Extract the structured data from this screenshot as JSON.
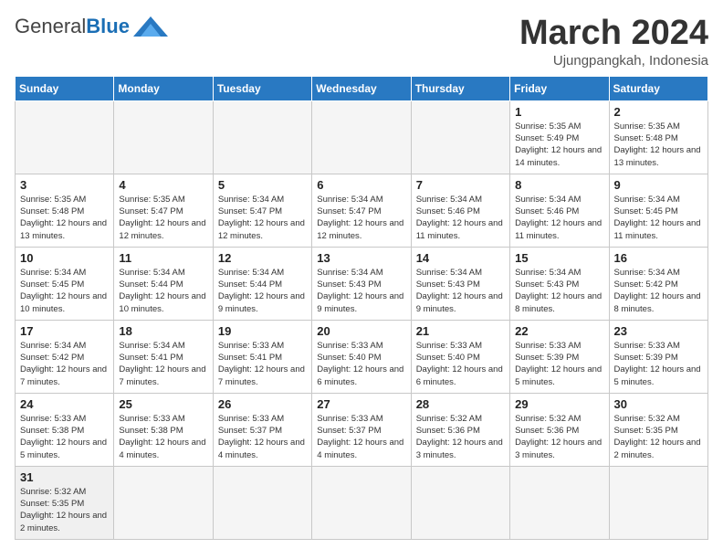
{
  "header": {
    "logo_general": "General",
    "logo_blue": "Blue",
    "month_title": "March 2024",
    "location": "Ujungpangkah, Indonesia"
  },
  "weekdays": [
    "Sunday",
    "Monday",
    "Tuesday",
    "Wednesday",
    "Thursday",
    "Friday",
    "Saturday"
  ],
  "weeks": [
    [
      {
        "day": "",
        "info": ""
      },
      {
        "day": "",
        "info": ""
      },
      {
        "day": "",
        "info": ""
      },
      {
        "day": "",
        "info": ""
      },
      {
        "day": "",
        "info": ""
      },
      {
        "day": "1",
        "info": "Sunrise: 5:35 AM\nSunset: 5:49 PM\nDaylight: 12 hours and 14 minutes."
      },
      {
        "day": "2",
        "info": "Sunrise: 5:35 AM\nSunset: 5:48 PM\nDaylight: 12 hours and 13 minutes."
      }
    ],
    [
      {
        "day": "3",
        "info": "Sunrise: 5:35 AM\nSunset: 5:48 PM\nDaylight: 12 hours and 13 minutes."
      },
      {
        "day": "4",
        "info": "Sunrise: 5:35 AM\nSunset: 5:47 PM\nDaylight: 12 hours and 12 minutes."
      },
      {
        "day": "5",
        "info": "Sunrise: 5:34 AM\nSunset: 5:47 PM\nDaylight: 12 hours and 12 minutes."
      },
      {
        "day": "6",
        "info": "Sunrise: 5:34 AM\nSunset: 5:47 PM\nDaylight: 12 hours and 12 minutes."
      },
      {
        "day": "7",
        "info": "Sunrise: 5:34 AM\nSunset: 5:46 PM\nDaylight: 12 hours and 11 minutes."
      },
      {
        "day": "8",
        "info": "Sunrise: 5:34 AM\nSunset: 5:46 PM\nDaylight: 12 hours and 11 minutes."
      },
      {
        "day": "9",
        "info": "Sunrise: 5:34 AM\nSunset: 5:45 PM\nDaylight: 12 hours and 11 minutes."
      }
    ],
    [
      {
        "day": "10",
        "info": "Sunrise: 5:34 AM\nSunset: 5:45 PM\nDaylight: 12 hours and 10 minutes."
      },
      {
        "day": "11",
        "info": "Sunrise: 5:34 AM\nSunset: 5:44 PM\nDaylight: 12 hours and 10 minutes."
      },
      {
        "day": "12",
        "info": "Sunrise: 5:34 AM\nSunset: 5:44 PM\nDaylight: 12 hours and 9 minutes."
      },
      {
        "day": "13",
        "info": "Sunrise: 5:34 AM\nSunset: 5:43 PM\nDaylight: 12 hours and 9 minutes."
      },
      {
        "day": "14",
        "info": "Sunrise: 5:34 AM\nSunset: 5:43 PM\nDaylight: 12 hours and 9 minutes."
      },
      {
        "day": "15",
        "info": "Sunrise: 5:34 AM\nSunset: 5:43 PM\nDaylight: 12 hours and 8 minutes."
      },
      {
        "day": "16",
        "info": "Sunrise: 5:34 AM\nSunset: 5:42 PM\nDaylight: 12 hours and 8 minutes."
      }
    ],
    [
      {
        "day": "17",
        "info": "Sunrise: 5:34 AM\nSunset: 5:42 PM\nDaylight: 12 hours and 7 minutes."
      },
      {
        "day": "18",
        "info": "Sunrise: 5:34 AM\nSunset: 5:41 PM\nDaylight: 12 hours and 7 minutes."
      },
      {
        "day": "19",
        "info": "Sunrise: 5:33 AM\nSunset: 5:41 PM\nDaylight: 12 hours and 7 minutes."
      },
      {
        "day": "20",
        "info": "Sunrise: 5:33 AM\nSunset: 5:40 PM\nDaylight: 12 hours and 6 minutes."
      },
      {
        "day": "21",
        "info": "Sunrise: 5:33 AM\nSunset: 5:40 PM\nDaylight: 12 hours and 6 minutes."
      },
      {
        "day": "22",
        "info": "Sunrise: 5:33 AM\nSunset: 5:39 PM\nDaylight: 12 hours and 5 minutes."
      },
      {
        "day": "23",
        "info": "Sunrise: 5:33 AM\nSunset: 5:39 PM\nDaylight: 12 hours and 5 minutes."
      }
    ],
    [
      {
        "day": "24",
        "info": "Sunrise: 5:33 AM\nSunset: 5:38 PM\nDaylight: 12 hours and 5 minutes."
      },
      {
        "day": "25",
        "info": "Sunrise: 5:33 AM\nSunset: 5:38 PM\nDaylight: 12 hours and 4 minutes."
      },
      {
        "day": "26",
        "info": "Sunrise: 5:33 AM\nSunset: 5:37 PM\nDaylight: 12 hours and 4 minutes."
      },
      {
        "day": "27",
        "info": "Sunrise: 5:33 AM\nSunset: 5:37 PM\nDaylight: 12 hours and 4 minutes."
      },
      {
        "day": "28",
        "info": "Sunrise: 5:32 AM\nSunset: 5:36 PM\nDaylight: 12 hours and 3 minutes."
      },
      {
        "day": "29",
        "info": "Sunrise: 5:32 AM\nSunset: 5:36 PM\nDaylight: 12 hours and 3 minutes."
      },
      {
        "day": "30",
        "info": "Sunrise: 5:32 AM\nSunset: 5:35 PM\nDaylight: 12 hours and 2 minutes."
      }
    ],
    [
      {
        "day": "31",
        "info": "Sunrise: 5:32 AM\nSunset: 5:35 PM\nDaylight: 12 hours and 2 minutes."
      },
      {
        "day": "",
        "info": ""
      },
      {
        "day": "",
        "info": ""
      },
      {
        "day": "",
        "info": ""
      },
      {
        "day": "",
        "info": ""
      },
      {
        "day": "",
        "info": ""
      },
      {
        "day": "",
        "info": ""
      }
    ]
  ]
}
